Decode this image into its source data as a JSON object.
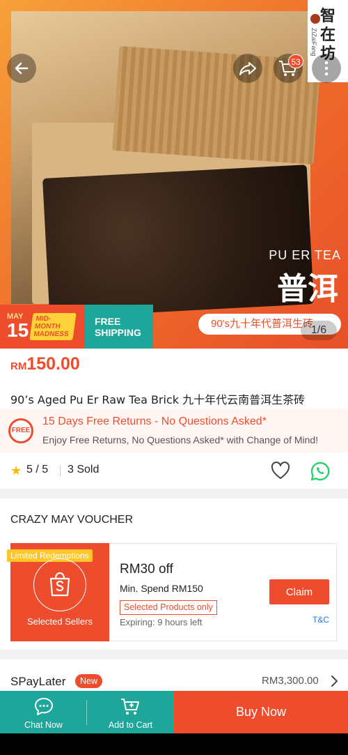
{
  "hero": {
    "brand_cn": "智在坊",
    "brand_en": "ZiZaiFang",
    "image_text_en": "PU ER TEA",
    "image_text_cn": "普洱",
    "image_pill": "90's九十年代普洱生砖",
    "image_counter": "1/6",
    "cart_count": "53",
    "promo_may_top": "MAY",
    "promo_may_day": "15",
    "promo_may_tag": "MID-MONTH MADNESS",
    "promo_free_shipping": "FREE SHIPPING",
    "icons": [
      "back-arrow-icon",
      "share-icon",
      "cart-icon",
      "more-icon"
    ]
  },
  "product": {
    "currency": "RM",
    "price": "150.00",
    "title": "90’s Aged Pu Er Raw Tea Brick 九十年代云南普洱生茶砖"
  },
  "returns": {
    "icon_label": "FREE",
    "title": "15 Days Free Returns - No Questions Asked*",
    "subtitle": "Enjoy Free Returns, No Questions Asked* with Change of Mind!"
  },
  "rating": {
    "value": "5 / 5",
    "sold": "3 Sold"
  },
  "voucher_section": {
    "heading": "CRAZY MAY VOUCHER",
    "limited_badge": "Limited Redemptions",
    "seller_label": "Selected Sellers",
    "amount": "RM30 off",
    "min_spend": "Min. Spend RM150",
    "tag": "Selected Products only",
    "expiry": "Expiring: 9 hours left",
    "claim_label": "Claim",
    "tnc_label": "T&C"
  },
  "spaylater": {
    "label": "SPayLater",
    "badge": "New",
    "amount": "RM3,300.00"
  },
  "bottom_bar": {
    "chat_label": "Chat Now",
    "add_cart_label": "Add to Cart",
    "buy_label": "Buy Now"
  },
  "colors": {
    "brand_orange": "#ee4d2d",
    "teal": "#1ea69a",
    "star": "#ffb800",
    "whatsapp": "#25d366",
    "link_blue": "#1f7ae0"
  }
}
